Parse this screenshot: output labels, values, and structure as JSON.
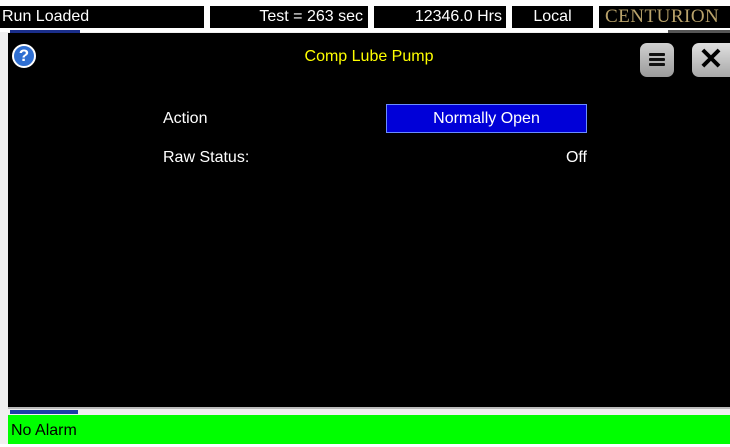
{
  "status_bar": {
    "mode": "Run Loaded",
    "test_timer": "Test = 263 sec",
    "hours": "12346.0 Hrs",
    "control": "Local",
    "brand": "CENTURION"
  },
  "dialog": {
    "title": "Comp Lube Pump",
    "help_icon": "help-icon",
    "menu_icon": "menu-icon",
    "close_icon": "close-icon",
    "help_glyph": "?",
    "close_glyph": "✕",
    "rows": [
      {
        "label": "Action",
        "value": "Normally Open"
      },
      {
        "label": "Raw Status:",
        "value": "Off"
      }
    ]
  },
  "alarm_bar": {
    "text": "No Alarm",
    "color": "#00ff00"
  },
  "colors": {
    "title": "#ffff00",
    "action_button": "#0000d8",
    "panel": "#000000"
  }
}
